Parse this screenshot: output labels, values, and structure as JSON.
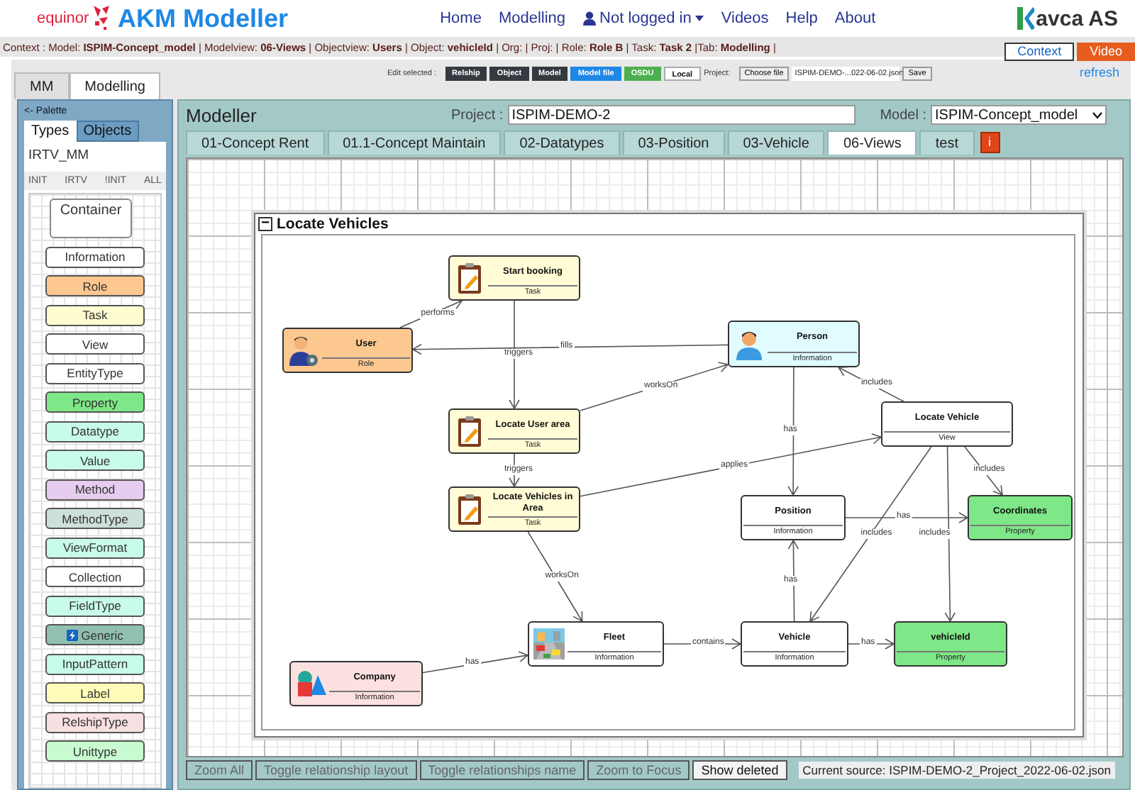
{
  "header": {
    "brand": "equinor",
    "title": "AKM Modeller",
    "nav": [
      {
        "label": "Home",
        "kind": "link"
      },
      {
        "label": "Modelling",
        "kind": "link"
      },
      {
        "label": "Not logged in",
        "kind": "user_menu"
      },
      {
        "label": "Videos",
        "kind": "link"
      },
      {
        "label": "Help",
        "kind": "link"
      },
      {
        "label": "About",
        "kind": "link"
      }
    ],
    "partner": "avca AS"
  },
  "context_bar": {
    "text": "Context : Model: **ISPIM-Concept_model** | Modelview: **06-Views** | Objectview: **Users** | Object: **vehicleId** | Org: | Proj: | Role: **Role B** | Task: **Task 2** |Tab: **Modelling** |",
    "buttons": [
      {
        "label": "Context",
        "kind": "outline"
      },
      {
        "label": "Video",
        "kind": "accent"
      }
    ]
  },
  "main_tabs": [
    {
      "label": "MM",
      "selected": false
    },
    {
      "label": "Modelling",
      "selected": true
    }
  ],
  "toolbar": {
    "label": "Edit selected :",
    "buttons": [
      {
        "label": "Relship",
        "kind": "dark"
      },
      {
        "label": "Object",
        "kind": "dark"
      },
      {
        "label": "Model",
        "kind": "dark"
      },
      {
        "label": "Model file",
        "kind": "blue"
      },
      {
        "label": "OSDU",
        "kind": "green"
      },
      {
        "label": "Local",
        "kind": "light"
      }
    ],
    "project_label": "Project:",
    "file_button": "Choose file",
    "file_name": "ISPIM-DEMO-...022-06-02.json",
    "save": "Save"
  },
  "refresh": "refresh",
  "palette": {
    "title": "<- Palette",
    "tabs": [
      {
        "label": "Types",
        "selected": true
      },
      {
        "label": "Objects",
        "selected": false
      }
    ],
    "metamodel": "IRTV_MM",
    "filters": [
      "INIT",
      "IRTV",
      "!INIT",
      "ALL"
    ],
    "items": [
      {
        "label": "Container",
        "kind": "container",
        "color": "#ffffff"
      },
      {
        "label": "Information",
        "kind": "type",
        "color": "#ffffff"
      },
      {
        "label": "Role",
        "kind": "type",
        "color": "#fdc890"
      },
      {
        "label": "Task",
        "kind": "type",
        "color": "#fffcd0"
      },
      {
        "label": "View",
        "kind": "type",
        "color": "#ffffff"
      },
      {
        "label": "EntityType",
        "kind": "type",
        "color": "#ffffff"
      },
      {
        "label": "Property",
        "kind": "type",
        "color": "#7ee787"
      },
      {
        "label": "Datatype",
        "kind": "type",
        "color": "#c8fbe8"
      },
      {
        "label": "Value",
        "kind": "type",
        "color": "#c8fbe8"
      },
      {
        "label": "Method",
        "kind": "type",
        "color": "#e6cdef"
      },
      {
        "label": "MethodType",
        "kind": "type",
        "color": "#cde0db"
      },
      {
        "label": "ViewFormat",
        "kind": "type",
        "color": "#c8fbe8"
      },
      {
        "label": "Collection",
        "kind": "type",
        "color": "#ffffff"
      },
      {
        "label": "FieldType",
        "kind": "type",
        "color": "#c8fbe8"
      },
      {
        "label": "Generic",
        "kind": "type_icon",
        "color": "#8fc0b0"
      },
      {
        "label": "InputPattern",
        "kind": "type",
        "color": "#c8fbe8"
      },
      {
        "label": "Label",
        "kind": "type",
        "color": "#fffbb8"
      },
      {
        "label": "RelshipType",
        "kind": "type",
        "color": "#f8e0e2"
      },
      {
        "label": "Unittype",
        "kind": "type",
        "color": "#c8fbd0"
      }
    ]
  },
  "modeller": {
    "title": "Modeller",
    "project_label": "Project :",
    "project": "ISPIM-DEMO-2",
    "model_label": "Model :",
    "model": "ISPIM-Concept_model",
    "tabs": [
      {
        "label": "01-Concept Rent",
        "selected": false
      },
      {
        "label": "01.1-Concept Maintain",
        "selected": false
      },
      {
        "label": "02-Datatypes",
        "selected": false
      },
      {
        "label": "03-Position",
        "selected": false
      },
      {
        "label": "03-Vehicle",
        "selected": false
      },
      {
        "label": "06-Views",
        "selected": true
      },
      {
        "label": "test",
        "selected": false
      }
    ],
    "info_button": "i",
    "group": {
      "toggle": "−",
      "title": "Locate Vehicles"
    },
    "nodes": [
      {
        "name": "Start booking",
        "type": "Task",
        "kind": "task",
        "color": "#fffcd6"
      },
      {
        "name": "User",
        "type": "Role",
        "kind": "role",
        "color": "#fdc890"
      },
      {
        "name": "Person",
        "type": "Information",
        "kind": "person",
        "color": "#e0fcff"
      },
      {
        "name": "Locate User area",
        "type": "Task",
        "kind": "task",
        "color": "#fffcd6"
      },
      {
        "name": "Locate Vehicle",
        "type": "View",
        "kind": "plain",
        "color": "#ffffff"
      },
      {
        "name": "Locate Vehicles in Area",
        "type": "Task",
        "kind": "task",
        "color": "#fffcd6"
      },
      {
        "name": "Position",
        "type": "Information",
        "kind": "plain",
        "color": "#ffffff"
      },
      {
        "name": "Coordinates",
        "type": "Property",
        "kind": "plain",
        "color": "#7ee787"
      },
      {
        "name": "Fleet",
        "type": "Information",
        "kind": "fleet",
        "color": "#ffffff"
      },
      {
        "name": "Vehicle",
        "type": "Information",
        "kind": "plain",
        "color": "#ffffff"
      },
      {
        "name": "vehicleId",
        "type": "Property",
        "kind": "plain",
        "color": "#7ee787"
      },
      {
        "name": "Company",
        "type": "Information",
        "kind": "company",
        "color": "#fde0e0"
      }
    ],
    "edges": [
      {
        "label": "performs"
      },
      {
        "label": "fills"
      },
      {
        "label": "triggers"
      },
      {
        "label": "worksOn"
      },
      {
        "label": "triggers"
      },
      {
        "label": "has"
      },
      {
        "label": "includes"
      },
      {
        "label": "applies"
      },
      {
        "label": "includes"
      },
      {
        "label": "has"
      },
      {
        "label": "includes"
      },
      {
        "label": "includes"
      },
      {
        "label": "worksOn"
      },
      {
        "label": "has"
      },
      {
        "label": "contains"
      },
      {
        "label": "has"
      },
      {
        "label": "has"
      }
    ],
    "actions": [
      {
        "label": "Zoom All",
        "disabled": true
      },
      {
        "label": "Toggle relationship layout",
        "disabled": true
      },
      {
        "label": "Toggle relationships name",
        "disabled": true
      },
      {
        "label": "Zoom to Focus",
        "disabled": true
      },
      {
        "label": "Show deleted",
        "disabled": false
      }
    ],
    "source": "Current source: ISPIM-DEMO-2_Project_2022-06-02.json"
  }
}
